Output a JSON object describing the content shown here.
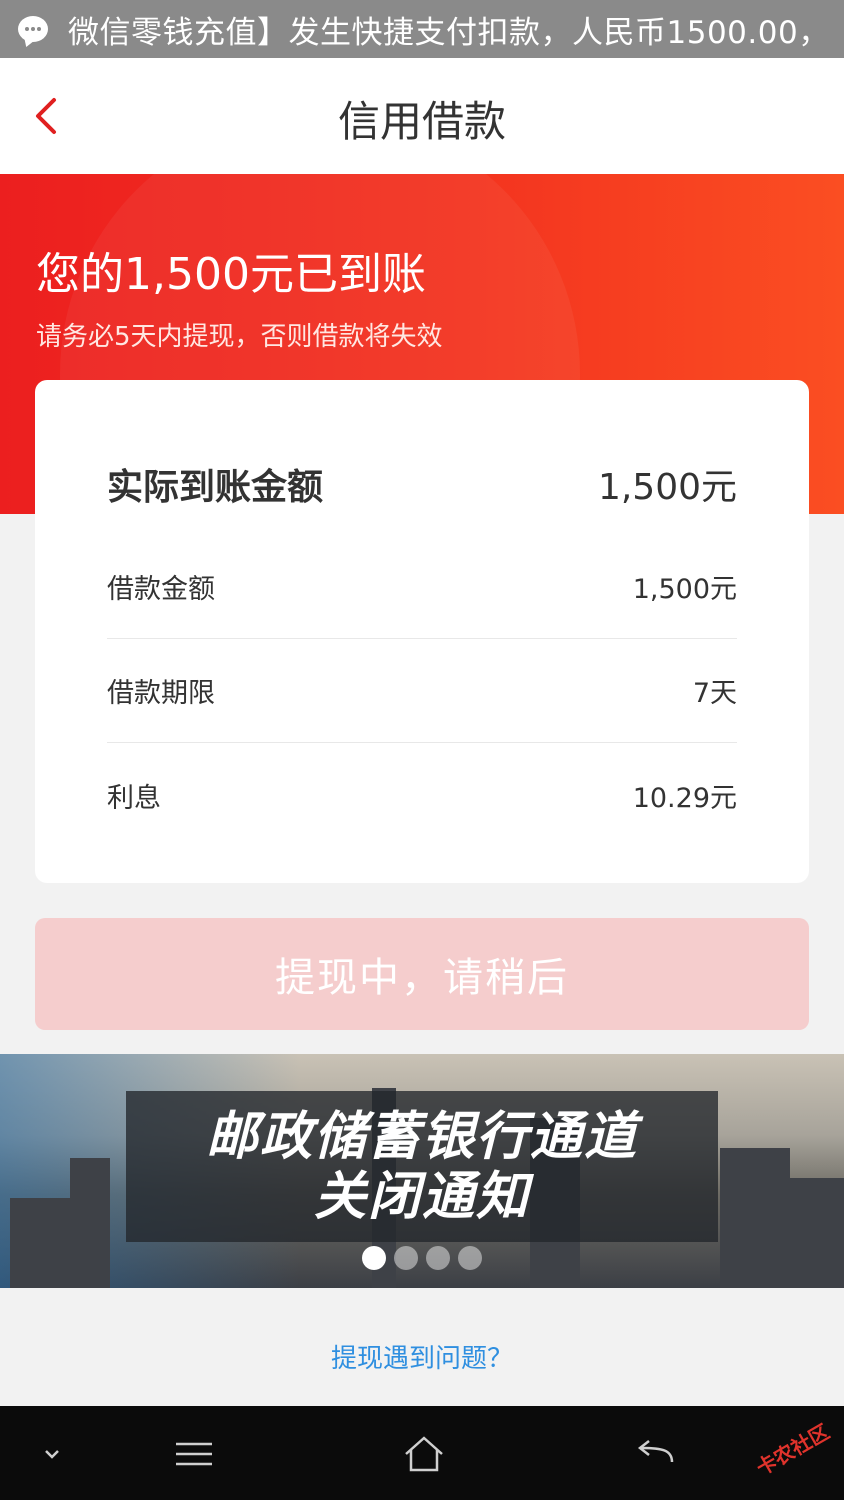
{
  "status_bar": {
    "notification_icon": "chat-bubble-icon",
    "notification_text": "微信零钱充值】发生快捷支付扣款，人民币1500.00，"
  },
  "header": {
    "back_icon": "chevron-left-icon",
    "title": "信用借款"
  },
  "hero": {
    "headline": "您的1,500元已到账",
    "subline": "请务必5天内提现，否则借款将失效"
  },
  "summary": {
    "main_label": "实际到账金额",
    "main_value": "1,500元",
    "rows": [
      {
        "label": "借款金额",
        "value": "1,500元"
      },
      {
        "label": "借款期限",
        "value": "7天"
      },
      {
        "label": "利息",
        "value": "10.29元"
      }
    ]
  },
  "withdraw_button": {
    "label": "提现中，请稍后",
    "state": "disabled"
  },
  "banner": {
    "line1": "邮政储蓄银行通道",
    "line2": "关闭通知",
    "slide_count": 4,
    "active_slide": 1
  },
  "help_link": "提现遇到问题？",
  "system_nav": {
    "icons": [
      "chevron-down-icon",
      "menu-icon",
      "home-icon",
      "back-arrow-icon"
    ],
    "watermark": "卡农社区"
  },
  "colors": {
    "accent_red": "#ec1f1f",
    "link_blue": "#2f8fe0",
    "disabled_button": "#f5cdcd"
  }
}
